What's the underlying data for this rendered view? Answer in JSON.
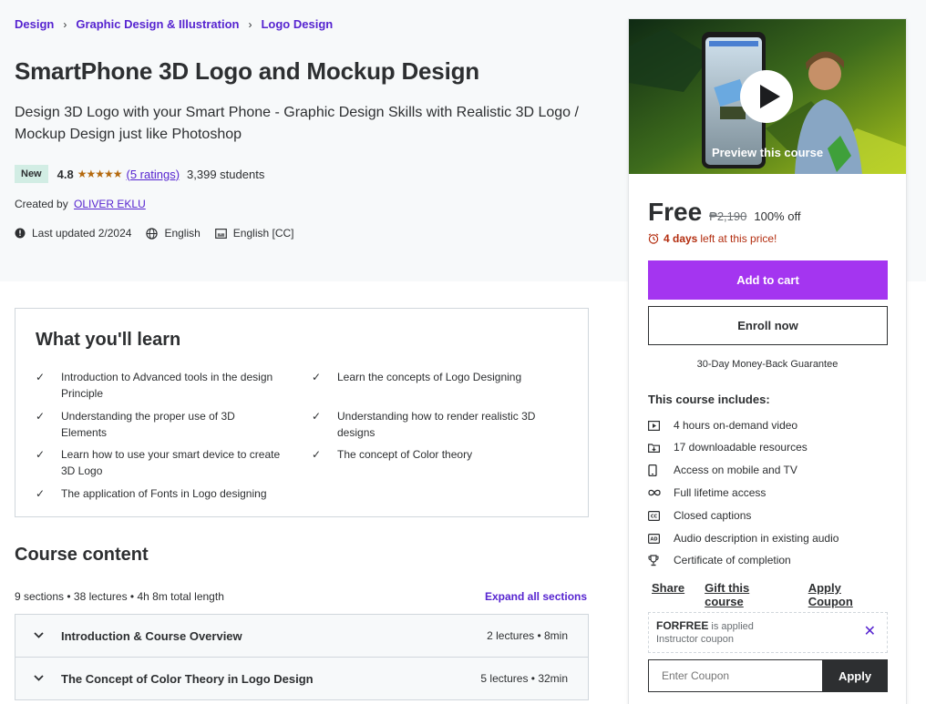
{
  "breadcrumb": [
    "Design",
    "Graphic Design & Illustration",
    "Logo Design"
  ],
  "course": {
    "title": "SmartPhone 3D Logo and Mockup Design",
    "subtitle": "Design 3D Logo with your Smart Phone - Graphic Design Skills with Realistic 3D Logo / Mockup Design just like Photoshop",
    "badge": "New",
    "rating": "4.8",
    "stars": "★★★★★",
    "ratings_link": "(5 ratings)",
    "students": "3,399 students",
    "created_by_label": "Created by",
    "author": "OLIVER EKLU",
    "last_updated": "Last updated 2/2024",
    "language": "English",
    "captions": "English [CC]"
  },
  "learn": {
    "title": "What you'll learn",
    "items": [
      "Introduction to Advanced tools in the design Principle",
      "Learn the concepts of Logo Designing",
      "Understanding the proper use of 3D Elements",
      "Understanding how to render realistic 3D designs",
      "Learn how to use your smart device to create 3D Logo",
      "The concept of Color theory",
      "The application of Fonts in Logo designing"
    ]
  },
  "content": {
    "title": "Course content",
    "summary": "9 sections • 38 lectures • 4h 8m total length",
    "expand_all": "Expand all sections",
    "sections": [
      {
        "name": "Introduction & Course Overview",
        "info": "2 lectures • 8min"
      },
      {
        "name": "The Concept of Color Theory in Logo Design",
        "info": "5 lectures • 32min"
      }
    ]
  },
  "sidebar": {
    "preview_label": "Preview this course",
    "price": "Free",
    "original_price": "₱2,190",
    "discount": "100% off",
    "timer_days": "4 days",
    "timer_rest": "left at this price!",
    "add_to_cart": "Add to cart",
    "enroll_now": "Enroll now",
    "guarantee": "30-Day Money-Back Guarantee",
    "includes_title": "This course includes:",
    "includes": [
      {
        "icon": "video-icon",
        "text": "4 hours on-demand video"
      },
      {
        "icon": "download-icon",
        "text": "17 downloadable resources"
      },
      {
        "icon": "mobile-icon",
        "text": "Access on mobile and TV"
      },
      {
        "icon": "infinity-icon",
        "text": "Full lifetime access"
      },
      {
        "icon": "captions-icon",
        "text": "Closed captions"
      },
      {
        "icon": "audio-description-icon",
        "text": "Audio description in existing audio"
      },
      {
        "icon": "trophy-icon",
        "text": "Certificate of completion"
      }
    ],
    "share": "Share",
    "gift": "Gift this course",
    "apply_coupon": "Apply Coupon",
    "coupon_code": "FORFREE",
    "coupon_applied": "is applied",
    "coupon_type": "Instructor coupon",
    "coupon_placeholder": "Enter Coupon",
    "apply": "Apply"
  },
  "colors": {
    "accent_purple": "#a435f0",
    "link_purple": "#5624d0",
    "star_orange": "#b4690e",
    "timer_red": "#b32d0f",
    "dark": "#2d2f31"
  }
}
